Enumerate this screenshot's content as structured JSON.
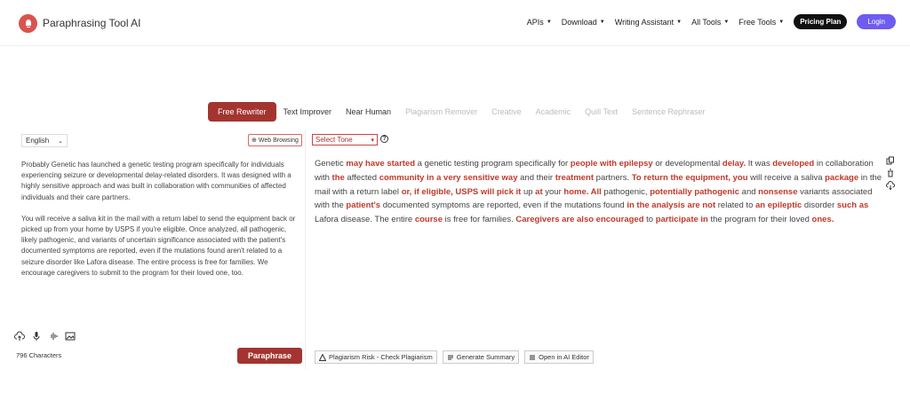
{
  "header": {
    "brand": "Paraphrasing Tool AI",
    "nav": [
      "APIs",
      "Download",
      "Writing Assistant",
      "All Tools",
      "Free Tools"
    ],
    "pricing_label": "Pricing Plan",
    "login_label": "Login"
  },
  "tabs": [
    {
      "label": "Free Rewriter",
      "state": "active"
    },
    {
      "label": "Text Improver",
      "state": "dark"
    },
    {
      "label": "Near Human",
      "state": "dark"
    },
    {
      "label": "Plagiarism Remover",
      "state": "muted"
    },
    {
      "label": "Creative",
      "state": "muted"
    },
    {
      "label": "Academic",
      "state": "muted"
    },
    {
      "label": "Quill Text",
      "state": "muted"
    },
    {
      "label": "Sentence Rephraser",
      "state": "muted"
    }
  ],
  "input": {
    "language": "English",
    "web_browsing_label": "Web Browsing",
    "paragraphs": [
      "Probably Genetic has launched a genetic testing program specifically for individuals experiencing seizure or developmental delay-related disorders. It was designed with a highly sensitive approach and was built in collaboration with communities of affected individuals and their care partners.",
      "You will receive a saliva kit in the mail with a return label to send the equipment back or picked up from your home by USPS if you're eligible. Once analyzed, all pathogenic, likely pathogenic, and variants of uncertain significance associated with the patient's documented symptoms are reported, even if the mutations found aren't related to a seizure disorder like Lafora disease. The entire process is free for families. We encourage caregivers to submit to the program for their loved one, too."
    ],
    "char_count": "796 Characters",
    "paraphrase_label": "Paraphrase"
  },
  "output": {
    "tone_placeholder": "Select Tone",
    "segments": [
      {
        "t": "Genetic ",
        "h": false
      },
      {
        "t": "may have started",
        "h": true
      },
      {
        "t": " a genetic testing program specifically for ",
        "h": false
      },
      {
        "t": "people with epilepsy",
        "h": true
      },
      {
        "t": " or developmental ",
        "h": false
      },
      {
        "t": "delay.",
        "h": true
      },
      {
        "t": " It was ",
        "h": false
      },
      {
        "t": "developed",
        "h": true
      },
      {
        "t": " in collaboration with ",
        "h": false
      },
      {
        "t": "the",
        "h": true
      },
      {
        "t": " affected ",
        "h": false
      },
      {
        "t": "community in a very sensitive way",
        "h": true
      },
      {
        "t": " and their ",
        "h": false
      },
      {
        "t": "treatment",
        "h": true
      },
      {
        "t": " partners. ",
        "h": false
      },
      {
        "t": "To return the equipment, you",
        "h": true
      },
      {
        "t": " will receive a saliva ",
        "h": false
      },
      {
        "t": "package",
        "h": true
      },
      {
        "t": " in the mail with a return label ",
        "h": false
      },
      {
        "t": "or, if eligible, USPS will pick it",
        "h": true
      },
      {
        "t": " up ",
        "h": false
      },
      {
        "t": "at",
        "h": true
      },
      {
        "t": " your ",
        "h": false
      },
      {
        "t": "home. All",
        "h": true
      },
      {
        "t": " pathogenic, ",
        "h": false
      },
      {
        "t": "potentially pathogenic",
        "h": true
      },
      {
        "t": " and ",
        "h": false
      },
      {
        "t": "nonsense",
        "h": true
      },
      {
        "t": " variants associated with the ",
        "h": false
      },
      {
        "t": "patient's",
        "h": true
      },
      {
        "t": " documented symptoms are reported, even if the mutations found ",
        "h": false
      },
      {
        "t": "in the analysis are not",
        "h": true
      },
      {
        "t": " related to ",
        "h": false
      },
      {
        "t": "an epileptic",
        "h": true
      },
      {
        "t": " disorder ",
        "h": false
      },
      {
        "t": "such as",
        "h": true
      },
      {
        "t": " Lafora disease. The entire ",
        "h": false
      },
      {
        "t": "course",
        "h": true
      },
      {
        "t": " is free for families. ",
        "h": false
      },
      {
        "t": "Caregivers are also encouraged",
        "h": true
      },
      {
        "t": " to ",
        "h": false
      },
      {
        "t": "participate in",
        "h": true
      },
      {
        "t": " the program for their loved ",
        "h": false
      },
      {
        "t": "ones.",
        "h": true
      }
    ],
    "buttons": [
      "Plagiarism Risk - Check Plagiarism",
      "Generate Summary",
      "Open in AI Editor"
    ]
  },
  "colors": {
    "accent": "#a33430",
    "highlight": "#c0392b",
    "login": "#6d5cf0"
  }
}
